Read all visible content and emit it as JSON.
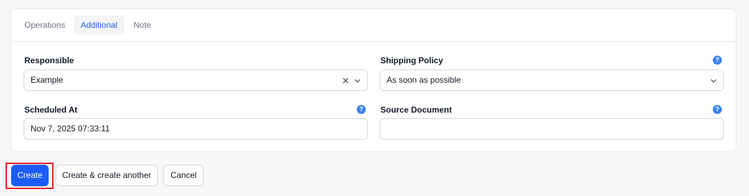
{
  "tabs": [
    {
      "label": "Operations"
    },
    {
      "label": "Additional"
    },
    {
      "label": "Note"
    }
  ],
  "form": {
    "responsible": {
      "label": "Responsible",
      "value": "Example"
    },
    "shipping_policy": {
      "label": "Shipping Policy",
      "value": "As soon as possible"
    },
    "scheduled_at": {
      "label": "Scheduled At",
      "value": "Nov 7, 2025 07:33:11"
    },
    "source_document": {
      "label": "Source Document",
      "value": ""
    }
  },
  "help_icon_glyph": "?",
  "buttons": {
    "create": "Create",
    "create_another": "Create & create another",
    "cancel": "Cancel"
  },
  "colors": {
    "accent": "#1d5cf5",
    "active_tab_text": "#2563eb",
    "highlight": "#e11d26"
  }
}
